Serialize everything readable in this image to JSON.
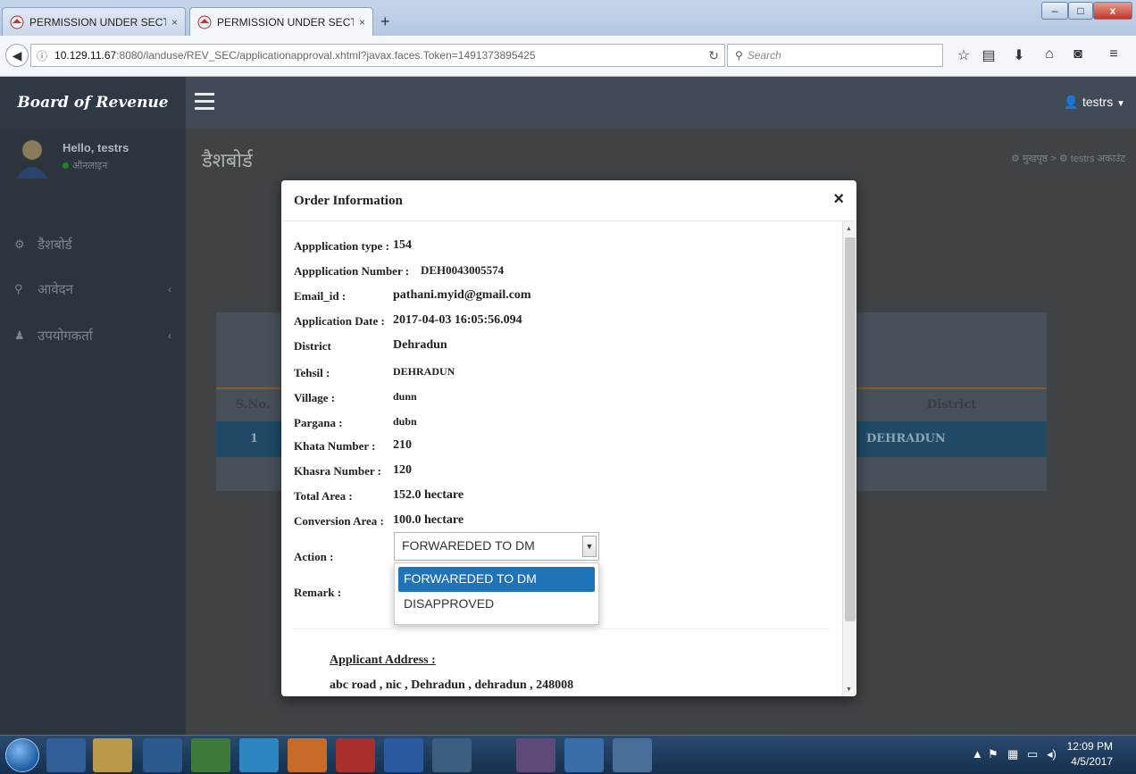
{
  "browser": {
    "tabs": [
      {
        "title": "PERMISSION UNDER SECTI...",
        "close": "×"
      },
      {
        "title": "PERMISSION UNDER SECTI...",
        "close": "×"
      }
    ],
    "new_tab": "+",
    "url_host": "10.129.11.67",
    "url_path": ":8080/landuse/REV_SEC/applicationapproval.xhtml?javax.faces.Token=1491373895425",
    "search_placeholder": "Search",
    "icons": [
      "star-icon",
      "reading-list-icon",
      "download-icon",
      "home-icon",
      "pocket-icon",
      "menu-icon"
    ]
  },
  "header": {
    "brand": "Board of Revenue",
    "user": "testrs"
  },
  "sidebar": {
    "hello": "Hello, testrs",
    "status": "ऑनलाइन",
    "items": [
      {
        "label": "डैशबोर्ड",
        "icon": "dashboard-icon"
      },
      {
        "label": "आवेदन",
        "icon": "search-icon"
      },
      {
        "label": "उपयोगकर्ता",
        "icon": "user-icon"
      }
    ]
  },
  "main": {
    "page_title": "डैशबोर्ड",
    "breadcrumb_home": "मुखपृष्ठ",
    "breadcrumb_account": "testrs अकाउंट",
    "table": {
      "col_sno": "S.No.",
      "col_district": "District",
      "row_sno": "1",
      "row_district": "DEHRADUN"
    }
  },
  "modal": {
    "title": "Order Information",
    "close": "×",
    "fields": [
      {
        "label": "Appplication type :",
        "value": "154"
      },
      {
        "label": "Appplication Number :",
        "value": "DEH0043005574"
      },
      {
        "label": "Email_id :",
        "value": "pathani.myid@gmail.com"
      },
      {
        "label": "Application Date :",
        "value": "2017-04-03 16:05:56.094"
      },
      {
        "label": "District",
        "value": "Dehradun"
      },
      {
        "label": "Tehsil :",
        "value": "DEHRADUN"
      },
      {
        "label": "Village :",
        "value": "dunn"
      },
      {
        "label": "Pargana :",
        "value": "dubn"
      },
      {
        "label": "Khata Number :",
        "value": "210"
      },
      {
        "label": "Khasra Number :",
        "value": "120"
      },
      {
        "label": "Total Area :",
        "value": "152.0 hectare"
      },
      {
        "label": "Conversion Area :",
        "value": "100.0 hectare"
      }
    ],
    "action_label": "Action :",
    "action_value": "FORWAREDED TO DM",
    "action_options": [
      "FORWAREDED TO DM",
      "DISAPPROVED"
    ],
    "remark_label": "Remark :",
    "address_title": "Applicant Address :",
    "address_value": "abc road , nic , Dehradun , dehradun , 248008"
  },
  "taskbar": {
    "time": "12:09 PM",
    "date": "4/5/2017"
  },
  "colors": {
    "header_bg": "#404b57",
    "brand_bg": "#2f3943",
    "selected_option": "#1f73b7"
  }
}
